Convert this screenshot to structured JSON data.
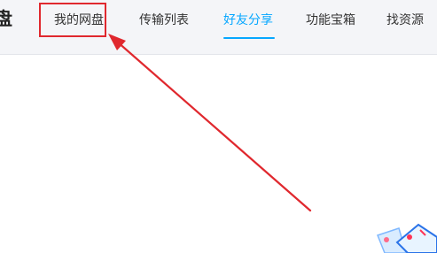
{
  "header": {
    "brand_fragment": "盘",
    "tabs": [
      {
        "id": "my-disk",
        "label": "我的网盘"
      },
      {
        "id": "transfer-list",
        "label": "传输列表"
      },
      {
        "id": "friend-share",
        "label": "好友分享",
        "active": true
      },
      {
        "id": "toolbox",
        "label": "功能宝箱"
      },
      {
        "id": "find-resources",
        "label": "找资源"
      }
    ]
  },
  "colors": {
    "accent": "#06a7ff",
    "annotation": "#e0282e",
    "topbar_bg": "#f4f5f8"
  },
  "icons": {
    "decoration": "illustration-fragment"
  }
}
